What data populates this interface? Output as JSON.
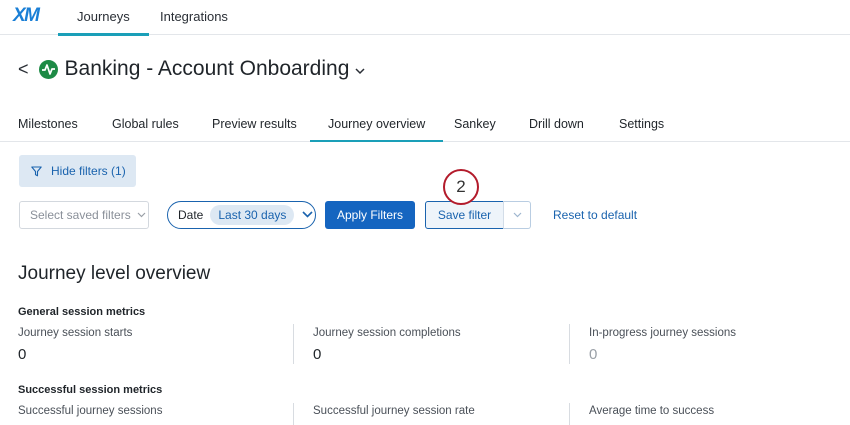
{
  "header": {
    "logo": "XM",
    "nav": [
      "Journeys",
      "Integrations"
    ]
  },
  "page": {
    "title": "Banking - Account Onboarding",
    "back_label": "<",
    "title_caret": "⌄"
  },
  "tabs": [
    "Milestones",
    "Global rules",
    "Preview results",
    "Journey overview",
    "Sankey",
    "Drill down",
    "Settings"
  ],
  "active_tab": "Journey overview",
  "filters": {
    "hide_filters_label": "Hide filters (1)",
    "saved_filters_placeholder": "Select saved filters",
    "date_label": "Date",
    "date_value": "Last 30 days",
    "apply_label": "Apply Filters",
    "save_label": "Save filter",
    "reset_label": "Reset to default"
  },
  "step_badge": "2",
  "overview": {
    "title": "Journey level overview",
    "general": {
      "heading": "General session metrics",
      "metrics": [
        {
          "label": "Journey session starts",
          "value": "0"
        },
        {
          "label": "Journey session completions",
          "value": "0"
        },
        {
          "label": "In-progress journey sessions",
          "value": "0"
        }
      ]
    },
    "successful": {
      "heading": "Successful session metrics",
      "metrics": [
        {
          "label": "Successful journey sessions"
        },
        {
          "label": "Successful journey session rate"
        },
        {
          "label": "Average time to success"
        }
      ]
    }
  },
  "colors": {
    "brand": "#1a7fd6",
    "accent_tab": "#1a9fb8",
    "primary_button": "#1565c0",
    "badge_ring": "#b31b2b",
    "journey_icon": "#1d8a45"
  }
}
